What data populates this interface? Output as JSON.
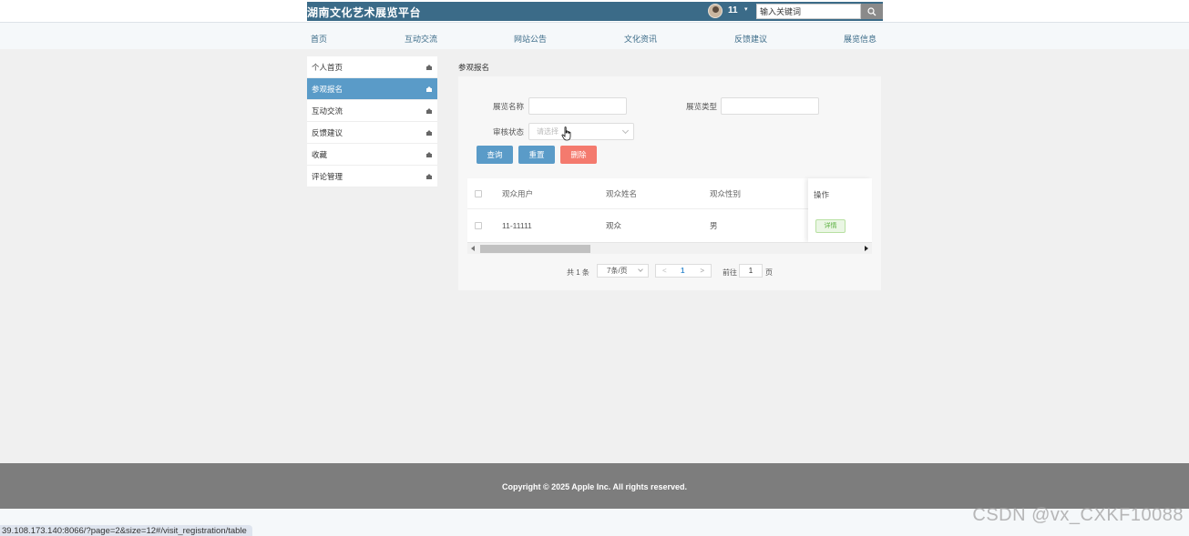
{
  "header": {
    "site_title": "湖南文化艺术展览平台",
    "username": "11",
    "user_caret": "▾",
    "search_placeholder": "输入关键词",
    "icons": {
      "avatar": "user-avatar",
      "search": "search-icon"
    },
    "colors": {
      "header_bg": "#3b6b88"
    }
  },
  "nav": {
    "items": [
      {
        "label": "首页"
      },
      {
        "label": "互动交流"
      },
      {
        "label": "网站公告"
      },
      {
        "label": "文化资讯"
      },
      {
        "label": "反馈建议"
      },
      {
        "label": "展览信息"
      }
    ]
  },
  "sidemenu": {
    "items": [
      {
        "label": "个人首页",
        "active": false
      },
      {
        "label": "参观报名",
        "active": true
      },
      {
        "label": "互动交流",
        "active": false
      },
      {
        "label": "反馈建议",
        "active": false
      },
      {
        "label": "收藏",
        "active": false
      },
      {
        "label": "评论管理",
        "active": false
      }
    ],
    "item_icon": "home-icon",
    "colors": {
      "active_bg": "#5a9bc8"
    }
  },
  "main": {
    "heading": "参观报名",
    "filters": {
      "exhibit_name_label": "展览名称",
      "exhibit_name_value": "",
      "exhibit_type_label": "展览类型",
      "exhibit_type_value": "",
      "review_status_label": "审核状态",
      "review_status_placeholder": "请选择"
    },
    "buttons": {
      "query": "查询",
      "reset": "重置",
      "delete": "删除"
    },
    "table": {
      "columns": [
        "观众用户",
        "观众姓名",
        "观众性别",
        "操作"
      ],
      "rows": [
        {
          "user": "11-11111",
          "name": "观众",
          "gender": "男",
          "action": "详情"
        }
      ]
    },
    "pagination": {
      "total": "共 1 条",
      "page_size": "7条/页",
      "prev": "<",
      "current_page": "1",
      "next": ">",
      "goto_label": "前往",
      "goto_value": "1",
      "page_unit": "页"
    },
    "colors": {
      "primary": "#5a9bc8",
      "danger": "#f47a6e",
      "success": "#5bb040"
    }
  },
  "footer": {
    "copyright": "Copyright © 2025 Apple Inc. All rights reserved."
  },
  "status_bar": {
    "url": "39.108.173.140:8066/?page=2&size=12#/visit_registration/table"
  },
  "watermark": "CSDN @vx_CXKF10088"
}
